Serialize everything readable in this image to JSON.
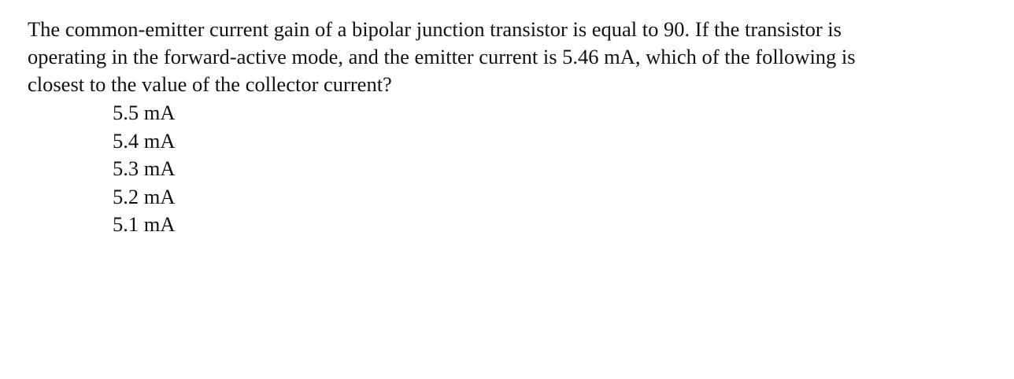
{
  "question": {
    "lines": [
      "The common-emitter current gain of a bipolar junction transistor is equal to 90.  If the transistor is",
      "operating in the forward-active mode, and the emitter current is 5.46 mA, which of the following is",
      "closest to the value of the collector current?"
    ]
  },
  "choices": [
    "5.5 mA",
    "5.4 mA",
    "5.3 mA",
    "5.2 mA",
    "5.1 mA"
  ]
}
